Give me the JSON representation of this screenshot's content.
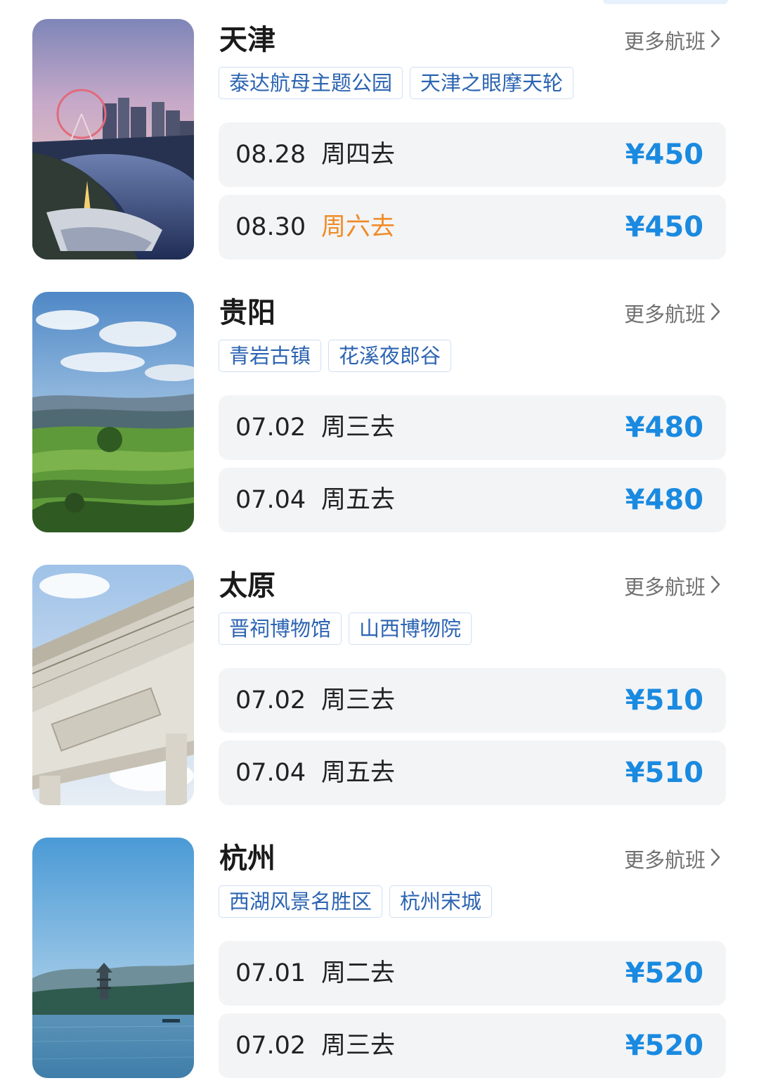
{
  "destinations": [
    {
      "city": "天津",
      "more": "更多航班",
      "image": "tianjin-eye-ferris-wheel-night",
      "tags": [
        "泰达航母主题公园",
        "天津之眼摩天轮"
      ],
      "flights": [
        {
          "date": "08.28",
          "day": "周四去",
          "price": "¥450",
          "weekend": false
        },
        {
          "date": "08.30",
          "day": "周六去",
          "price": "¥450",
          "weekend": true
        }
      ]
    },
    {
      "city": "贵阳",
      "more": "更多航班",
      "image": "guiyang-terraced-fields",
      "tags": [
        "青岩古镇",
        "花溪夜郎谷"
      ],
      "flights": [
        {
          "date": "07.02",
          "day": "周三去",
          "price": "¥480",
          "weekend": false
        },
        {
          "date": "07.04",
          "day": "周五去",
          "price": "¥480",
          "weekend": false
        }
      ]
    },
    {
      "city": "太原",
      "more": "更多航班",
      "image": "taiyuan-stone-archway",
      "tags": [
        "晋祠博物馆",
        "山西博物院"
      ],
      "flights": [
        {
          "date": "07.02",
          "day": "周三去",
          "price": "¥510",
          "weekend": false
        },
        {
          "date": "07.04",
          "day": "周五去",
          "price": "¥510",
          "weekend": false
        }
      ]
    },
    {
      "city": "杭州",
      "more": "更多航班",
      "image": "hangzhou-west-lake-pagoda",
      "tags": [
        "西湖风景名胜区",
        "杭州宋城"
      ],
      "flights": [
        {
          "date": "07.01",
          "day": "周二去",
          "price": "¥520",
          "weekend": false
        },
        {
          "date": "07.02",
          "day": "周三去",
          "price": "¥520",
          "weekend": false
        }
      ]
    }
  ],
  "colors": {
    "price": "#1a8ae0",
    "weekend": "#f08c28",
    "tag_text": "#2c64b2",
    "tag_border": "#cfe0f3",
    "row_bg": "#f3f4f6"
  }
}
